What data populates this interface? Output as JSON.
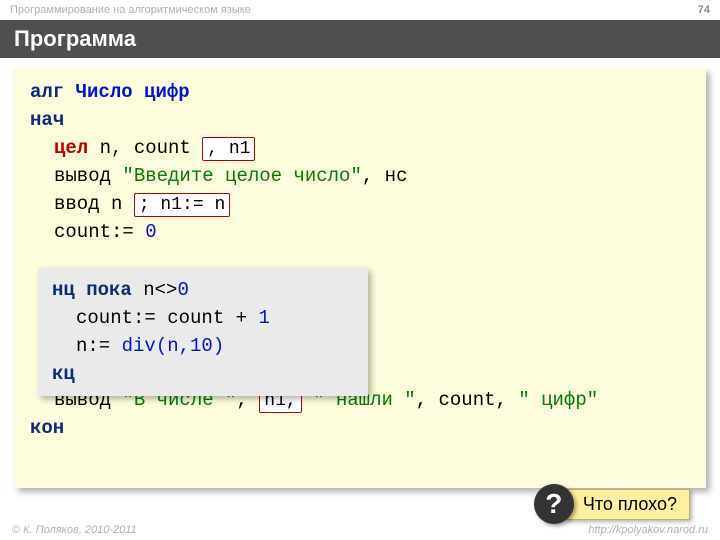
{
  "header": {
    "course": "Программирование на алгоритмическом языке",
    "page_num": "74"
  },
  "title": "Программа",
  "code": {
    "alg": "алг",
    "prog_name": "Число цифр",
    "nach": "нач",
    "tsel": "цел",
    "decl_rest": " n, count",
    "hl1": ", n1",
    "vyvod": "вывод",
    "prompt_str": "\"Введите целое число\"",
    "ns": ", нс",
    "vvod": "ввод",
    "vvod_n": " n",
    "hl2": "; n1:= n",
    "count_init_lhs": "count:= ",
    "zero": "0",
    "loop_nts": "нц пока",
    "loop_cond_n": " n",
    "loop_op": "<>",
    "loop_zero": "0",
    "loop_inc_lhs": "count:= count",
    "loop_inc_op": " + ",
    "loop_inc_rhs": "1",
    "loop_assign_n": "n:= ",
    "loop_div": "div(n,10)",
    "kts": "кц",
    "out2_pre": "\"В числе \"",
    "out2_comma": ", ",
    "hl3": "n1,",
    "out2_mid": "\" нашли \"",
    "out2_count": ", count, ",
    "out2_suf": "\" цифр\"",
    "kon": "кон"
  },
  "callout": {
    "badge": "?",
    "text": "Что плохо?"
  },
  "footer": {
    "copyright": "© К. Поляков, 2010-2011",
    "url": "http://kpolyakov.narod.ru"
  }
}
